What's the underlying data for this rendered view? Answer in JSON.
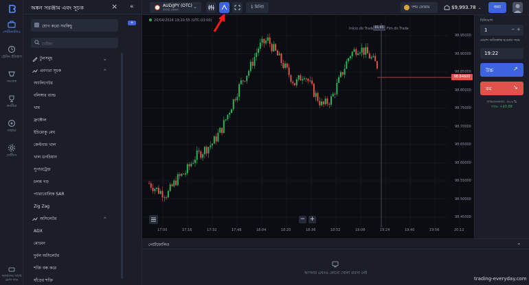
{
  "rail": {
    "items": [
      {
        "label": "পোর্টফোলিও",
        "icon": "portfolio-icon",
        "active": true
      },
      {
        "label": "ট্রেডিং ইতিহাস",
        "icon": "history-icon"
      },
      {
        "label": "সংকেত",
        "icon": "signals-icon"
      },
      {
        "label": "ক্যাটিয়া",
        "icon": "trophy-icon"
      },
      {
        "label": "সাহায্য",
        "icon": "help-icon"
      },
      {
        "label": "সেটিংস",
        "icon": "settings-icon"
      }
    ],
    "bottom_line1": "আমাদের সাথে",
    "bottom_line2": "যোগ দাও"
  },
  "panel": {
    "title": "অঙ্কন সরঞ্জাম এবং সূচক",
    "add_label": "যোগ করো সবকিছু",
    "badge": "+",
    "search_placeholder": "খোঁজা",
    "items": [
      {
        "label": "টুলসমূহ",
        "group": true,
        "chev": "⌄"
      },
      {
        "label": "প্রবণতা সূচক",
        "group": true,
        "chev": "⌃"
      },
      {
        "label": "অ্যালিগেটর"
      },
      {
        "label": "বলিঙ্গার ব্যান্ড"
      },
      {
        "label": "খাম"
      },
      {
        "label": "ফ্র্যাক্টাল"
      },
      {
        "label": "ইচিমোকু মেঘ"
      },
      {
        "label": "কেল্টনার খাল"
      },
      {
        "label": "খাল ডনচিয়ান"
      },
      {
        "label": "সুপারট্রেন্ড"
      },
      {
        "label": "চলন্ত গড়"
      },
      {
        "label": "প্যারাবোলিক SAR"
      },
      {
        "label": "Zig Zag"
      },
      {
        "label": "অসিলেটর",
        "group": true,
        "chev": "⌃"
      },
      {
        "label": "ADX"
      },
      {
        "label": "মোমেন"
      },
      {
        "label": "দুর্বল অসিলেটর"
      },
      {
        "label": "শক্তি বন্ধ করে"
      },
      {
        "label": "ষাঁড়ের শক্তি"
      }
    ]
  },
  "topbar": {
    "asset_name": "AUD/JPY (OTC)",
    "asset_sub": "দিগিট বেফল",
    "timeframe": "1 মিনিট",
    "demo_label": "দশম ফোরাম",
    "balance": "$9,993.78",
    "deposit_label": "জমা"
  },
  "chart": {
    "info": "20/04/2024 19:20:55 (UTC-03:00)",
    "trade_start_label": "Início do Trade",
    "trade_end_label": "Fim do Trade",
    "trade_timer": "01:05",
    "current_price": "98.84600",
    "y_ticks": [
      "98.95000",
      "98.90000",
      "98.85000",
      "98.80000",
      "98.75000",
      "98.70000",
      "98.65000",
      "98.60000",
      "98.55000",
      "98.50000",
      "98.45000"
    ],
    "x_ticks": [
      "17:00",
      "17:16",
      "17:32",
      "17:48",
      "18:04",
      "18:20",
      "18:36",
      "18:52",
      "19:08",
      "19:24",
      "19:40",
      "19:56",
      "20:12"
    ],
    "zoom_minus": "−",
    "zoom_plus": "+"
  },
  "chart_data": {
    "type": "candlestick",
    "ylim": [
      98.43,
      98.97
    ],
    "x": [
      "17:00",
      "17:16",
      "17:32",
      "17:48",
      "18:04",
      "18:20",
      "18:36",
      "18:52",
      "19:08",
      "19:24",
      "19:40",
      "19:56",
      "20:12"
    ],
    "trend_close": [
      98.55,
      98.53,
      98.52,
      98.56,
      98.58,
      98.62,
      98.64,
      98.66,
      98.7,
      98.76,
      98.82,
      98.86,
      98.92,
      98.94,
      98.9,
      98.86,
      98.82,
      98.85,
      98.8,
      98.76,
      98.78,
      98.84,
      98.9,
      98.92,
      98.9,
      98.87
    ],
    "colors": {
      "up": "#2bb55b",
      "down": "#e2524c",
      "price_line": "#e2524c"
    }
  },
  "trade": {
    "duration_label": "বিনিয়োগ",
    "amount": "1",
    "stp_minus": "−",
    "stp_plus": "+",
    "time_label": "মেয়াদ অতিক্রান্ত হওয়ার সময়",
    "time": "19:22",
    "up_label": "উচ্চ",
    "down_label": "কম",
    "payout_label": "লাভজনকতা: +৮৮%",
    "payout_value": "লাভ: +$0.88"
  },
  "bottom": {
    "title": "পোর্টফোলিও",
    "empty": "আপনার এখনও কোনো খোলা ব্যবসা নেই",
    "watermark": "trading-everyday.com"
  }
}
